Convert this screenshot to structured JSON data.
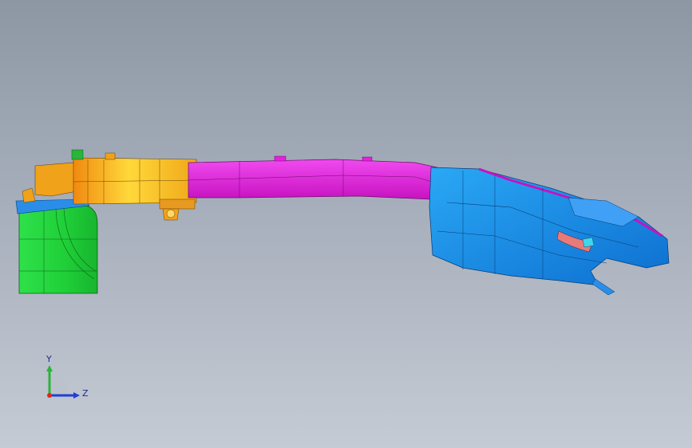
{
  "viewport": {
    "background_top": "#8d97a4",
    "background_bottom": "#c5cbd4"
  },
  "model": {
    "part_colors": {
      "green_block": "#22e03a",
      "orange_bracket": "#f0a21a",
      "yellow_gradient": "#ffd83a",
      "magenta_beam": "#e81fe0",
      "blue_assembly": "#1a8ee8",
      "cyan_accent": "#3fd6f0"
    }
  },
  "triad": {
    "y_label": "Y",
    "z_label": "Z",
    "y_color": "#2bb33b",
    "z_color": "#1f3fd6",
    "x_color": "#e0261a"
  }
}
